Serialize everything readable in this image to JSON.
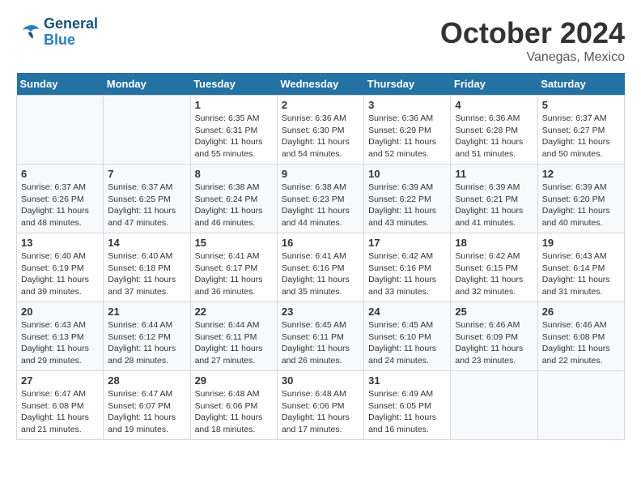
{
  "header": {
    "logo_line1": "General",
    "logo_line2": "Blue",
    "month": "October 2024",
    "location": "Vanegas, Mexico"
  },
  "weekdays": [
    "Sunday",
    "Monday",
    "Tuesday",
    "Wednesday",
    "Thursday",
    "Friday",
    "Saturday"
  ],
  "weeks": [
    [
      {
        "day": "",
        "info": ""
      },
      {
        "day": "",
        "info": ""
      },
      {
        "day": "1",
        "info": "Sunrise: 6:35 AM\nSunset: 6:31 PM\nDaylight: 11 hours and 55 minutes."
      },
      {
        "day": "2",
        "info": "Sunrise: 6:36 AM\nSunset: 6:30 PM\nDaylight: 11 hours and 54 minutes."
      },
      {
        "day": "3",
        "info": "Sunrise: 6:36 AM\nSunset: 6:29 PM\nDaylight: 11 hours and 52 minutes."
      },
      {
        "day": "4",
        "info": "Sunrise: 6:36 AM\nSunset: 6:28 PM\nDaylight: 11 hours and 51 minutes."
      },
      {
        "day": "5",
        "info": "Sunrise: 6:37 AM\nSunset: 6:27 PM\nDaylight: 11 hours and 50 minutes."
      }
    ],
    [
      {
        "day": "6",
        "info": "Sunrise: 6:37 AM\nSunset: 6:26 PM\nDaylight: 11 hours and 48 minutes."
      },
      {
        "day": "7",
        "info": "Sunrise: 6:37 AM\nSunset: 6:25 PM\nDaylight: 11 hours and 47 minutes."
      },
      {
        "day": "8",
        "info": "Sunrise: 6:38 AM\nSunset: 6:24 PM\nDaylight: 11 hours and 46 minutes."
      },
      {
        "day": "9",
        "info": "Sunrise: 6:38 AM\nSunset: 6:23 PM\nDaylight: 11 hours and 44 minutes."
      },
      {
        "day": "10",
        "info": "Sunrise: 6:39 AM\nSunset: 6:22 PM\nDaylight: 11 hours and 43 minutes."
      },
      {
        "day": "11",
        "info": "Sunrise: 6:39 AM\nSunset: 6:21 PM\nDaylight: 11 hours and 41 minutes."
      },
      {
        "day": "12",
        "info": "Sunrise: 6:39 AM\nSunset: 6:20 PM\nDaylight: 11 hours and 40 minutes."
      }
    ],
    [
      {
        "day": "13",
        "info": "Sunrise: 6:40 AM\nSunset: 6:19 PM\nDaylight: 11 hours and 39 minutes."
      },
      {
        "day": "14",
        "info": "Sunrise: 6:40 AM\nSunset: 6:18 PM\nDaylight: 11 hours and 37 minutes."
      },
      {
        "day": "15",
        "info": "Sunrise: 6:41 AM\nSunset: 6:17 PM\nDaylight: 11 hours and 36 minutes."
      },
      {
        "day": "16",
        "info": "Sunrise: 6:41 AM\nSunset: 6:16 PM\nDaylight: 11 hours and 35 minutes."
      },
      {
        "day": "17",
        "info": "Sunrise: 6:42 AM\nSunset: 6:16 PM\nDaylight: 11 hours and 33 minutes."
      },
      {
        "day": "18",
        "info": "Sunrise: 6:42 AM\nSunset: 6:15 PM\nDaylight: 11 hours and 32 minutes."
      },
      {
        "day": "19",
        "info": "Sunrise: 6:43 AM\nSunset: 6:14 PM\nDaylight: 11 hours and 31 minutes."
      }
    ],
    [
      {
        "day": "20",
        "info": "Sunrise: 6:43 AM\nSunset: 6:13 PM\nDaylight: 11 hours and 29 minutes."
      },
      {
        "day": "21",
        "info": "Sunrise: 6:44 AM\nSunset: 6:12 PM\nDaylight: 11 hours and 28 minutes."
      },
      {
        "day": "22",
        "info": "Sunrise: 6:44 AM\nSunset: 6:11 PM\nDaylight: 11 hours and 27 minutes."
      },
      {
        "day": "23",
        "info": "Sunrise: 6:45 AM\nSunset: 6:11 PM\nDaylight: 11 hours and 26 minutes."
      },
      {
        "day": "24",
        "info": "Sunrise: 6:45 AM\nSunset: 6:10 PM\nDaylight: 11 hours and 24 minutes."
      },
      {
        "day": "25",
        "info": "Sunrise: 6:46 AM\nSunset: 6:09 PM\nDaylight: 11 hours and 23 minutes."
      },
      {
        "day": "26",
        "info": "Sunrise: 6:46 AM\nSunset: 6:08 PM\nDaylight: 11 hours and 22 minutes."
      }
    ],
    [
      {
        "day": "27",
        "info": "Sunrise: 6:47 AM\nSunset: 6:08 PM\nDaylight: 11 hours and 21 minutes."
      },
      {
        "day": "28",
        "info": "Sunrise: 6:47 AM\nSunset: 6:07 PM\nDaylight: 11 hours and 19 minutes."
      },
      {
        "day": "29",
        "info": "Sunrise: 6:48 AM\nSunset: 6:06 PM\nDaylight: 11 hours and 18 minutes."
      },
      {
        "day": "30",
        "info": "Sunrise: 6:48 AM\nSunset: 6:06 PM\nDaylight: 11 hours and 17 minutes."
      },
      {
        "day": "31",
        "info": "Sunrise: 6:49 AM\nSunset: 6:05 PM\nDaylight: 11 hours and 16 minutes."
      },
      {
        "day": "",
        "info": ""
      },
      {
        "day": "",
        "info": ""
      }
    ]
  ]
}
